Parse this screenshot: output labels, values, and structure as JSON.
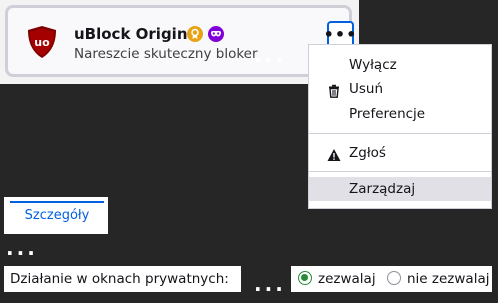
{
  "extension": {
    "name": "uBlock Origin",
    "description": "Nareszcie skuteczny bloker",
    "more_button_label": "•••",
    "colors": {
      "logo": "#800000",
      "recommended_badge": "#e8a314",
      "private_badge": "#8000d7",
      "accent": "#0060df"
    }
  },
  "ellipsis": "...",
  "menu": {
    "items": [
      {
        "label": "Wyłącz",
        "icon": ""
      },
      {
        "label": "Usuń",
        "icon": "trash-icon"
      },
      {
        "label": "Preferencje",
        "icon": ""
      },
      {
        "label": "Zgłoś",
        "icon": "warning-icon"
      },
      {
        "label": "Zarządzaj",
        "icon": "",
        "highlighted": true
      }
    ]
  },
  "tabs": {
    "details": "Szczegóły"
  },
  "private": {
    "label": "Działanie w oknach prywatnych:",
    "options": [
      {
        "label": "zezwalaj",
        "selected": true
      },
      {
        "label": "nie zezwalaj",
        "selected": false
      }
    ]
  }
}
